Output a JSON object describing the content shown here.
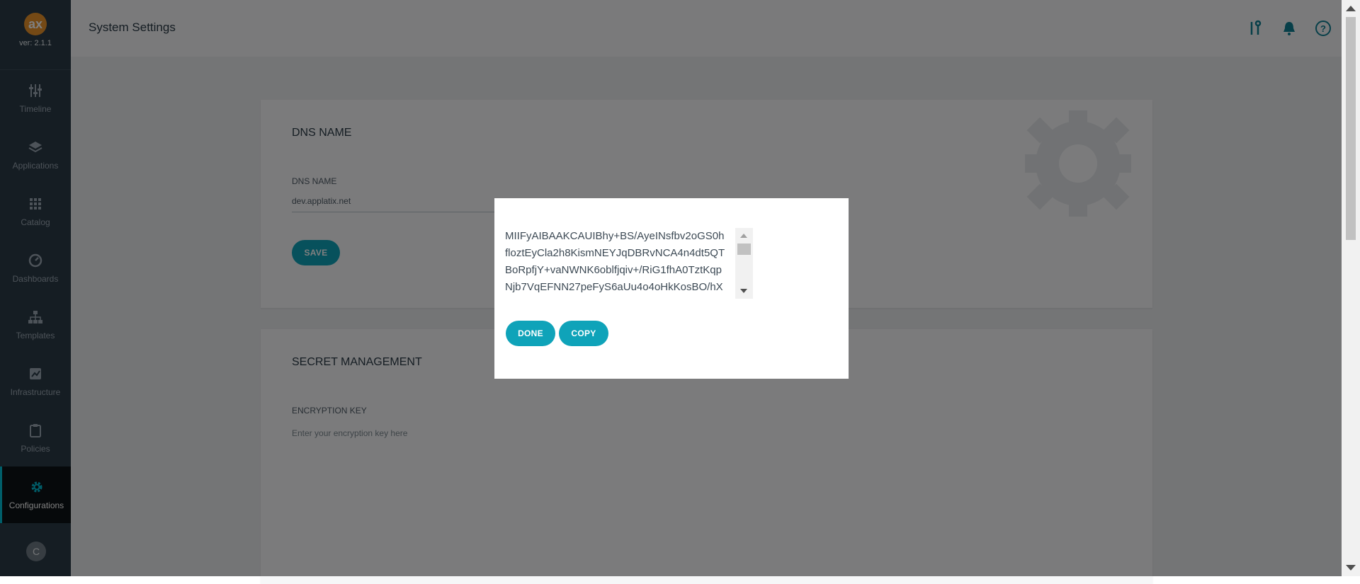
{
  "app": {
    "version": "ver: 2.1.1",
    "logo_text": "ax"
  },
  "sidebar": {
    "items": [
      {
        "label": "Timeline",
        "icon": "timeline-icon"
      },
      {
        "label": "Applications",
        "icon": "layers-icon"
      },
      {
        "label": "Catalog",
        "icon": "grid-icon"
      },
      {
        "label": "Dashboards",
        "icon": "dashboard-icon"
      },
      {
        "label": "Templates",
        "icon": "sitemap-icon"
      },
      {
        "label": "Infrastructure",
        "icon": "infrastructure-icon"
      },
      {
        "label": "Policies",
        "icon": "clipboard-icon"
      },
      {
        "label": "Configurations",
        "icon": "gear-icon"
      }
    ],
    "active": "Configurations",
    "avatar_initial": "C"
  },
  "header": {
    "title": "System Settings",
    "icons": [
      "tools-icon",
      "bell-icon",
      "help-icon"
    ]
  },
  "dns_card": {
    "title": "DNS NAME",
    "field_label": "DNS NAME",
    "field_value": "dev.applatix.net",
    "save_label": "SAVE"
  },
  "secret_card": {
    "title": "SECRET MANAGEMENT",
    "field_label": "ENCRYPTION KEY",
    "placeholder": "Enter your encryption key here"
  },
  "modal": {
    "key_lines": [
      "MIIFyAIBAAKCAUIBhy+BS/AyeINsfbv2oGS0h",
      "floztEyCla2h8KismNEYJqDBRvNCA4n4dt5QT",
      "BoRpfjY+vaNWNK6oblfjqiv+/RiG1fhA0TztKqp",
      "Njb7VqEFNN27peFyS6aUu4o4oHkKosBO/hX"
    ],
    "done_label": "DONE",
    "copy_label": "COPY"
  },
  "colors": {
    "accent": "#0fa3b9",
    "sidebar_bg": "#2b3a47",
    "logo": "#e8922a"
  }
}
